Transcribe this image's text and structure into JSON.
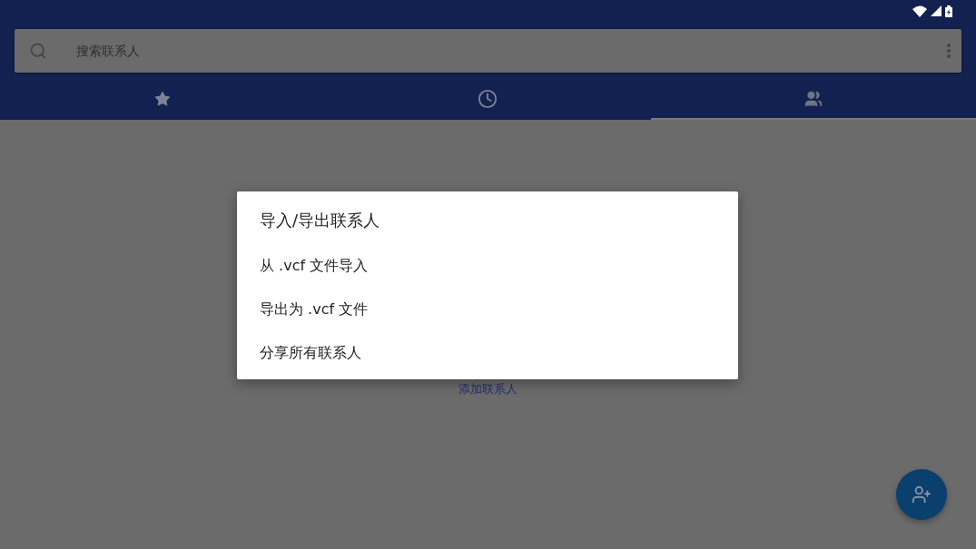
{
  "search": {
    "placeholder": "搜索联系人"
  },
  "tabs": [
    {
      "kind": "favorites",
      "selected": false
    },
    {
      "kind": "recent",
      "selected": false
    },
    {
      "kind": "contacts",
      "selected": true
    }
  ],
  "empty_state": {
    "link": "添加联系人"
  },
  "dialog": {
    "title": "导入/导出联系人",
    "items": [
      "从 .vcf 文件导入",
      "导出为 .vcf 文件",
      "分享所有联系人"
    ]
  }
}
